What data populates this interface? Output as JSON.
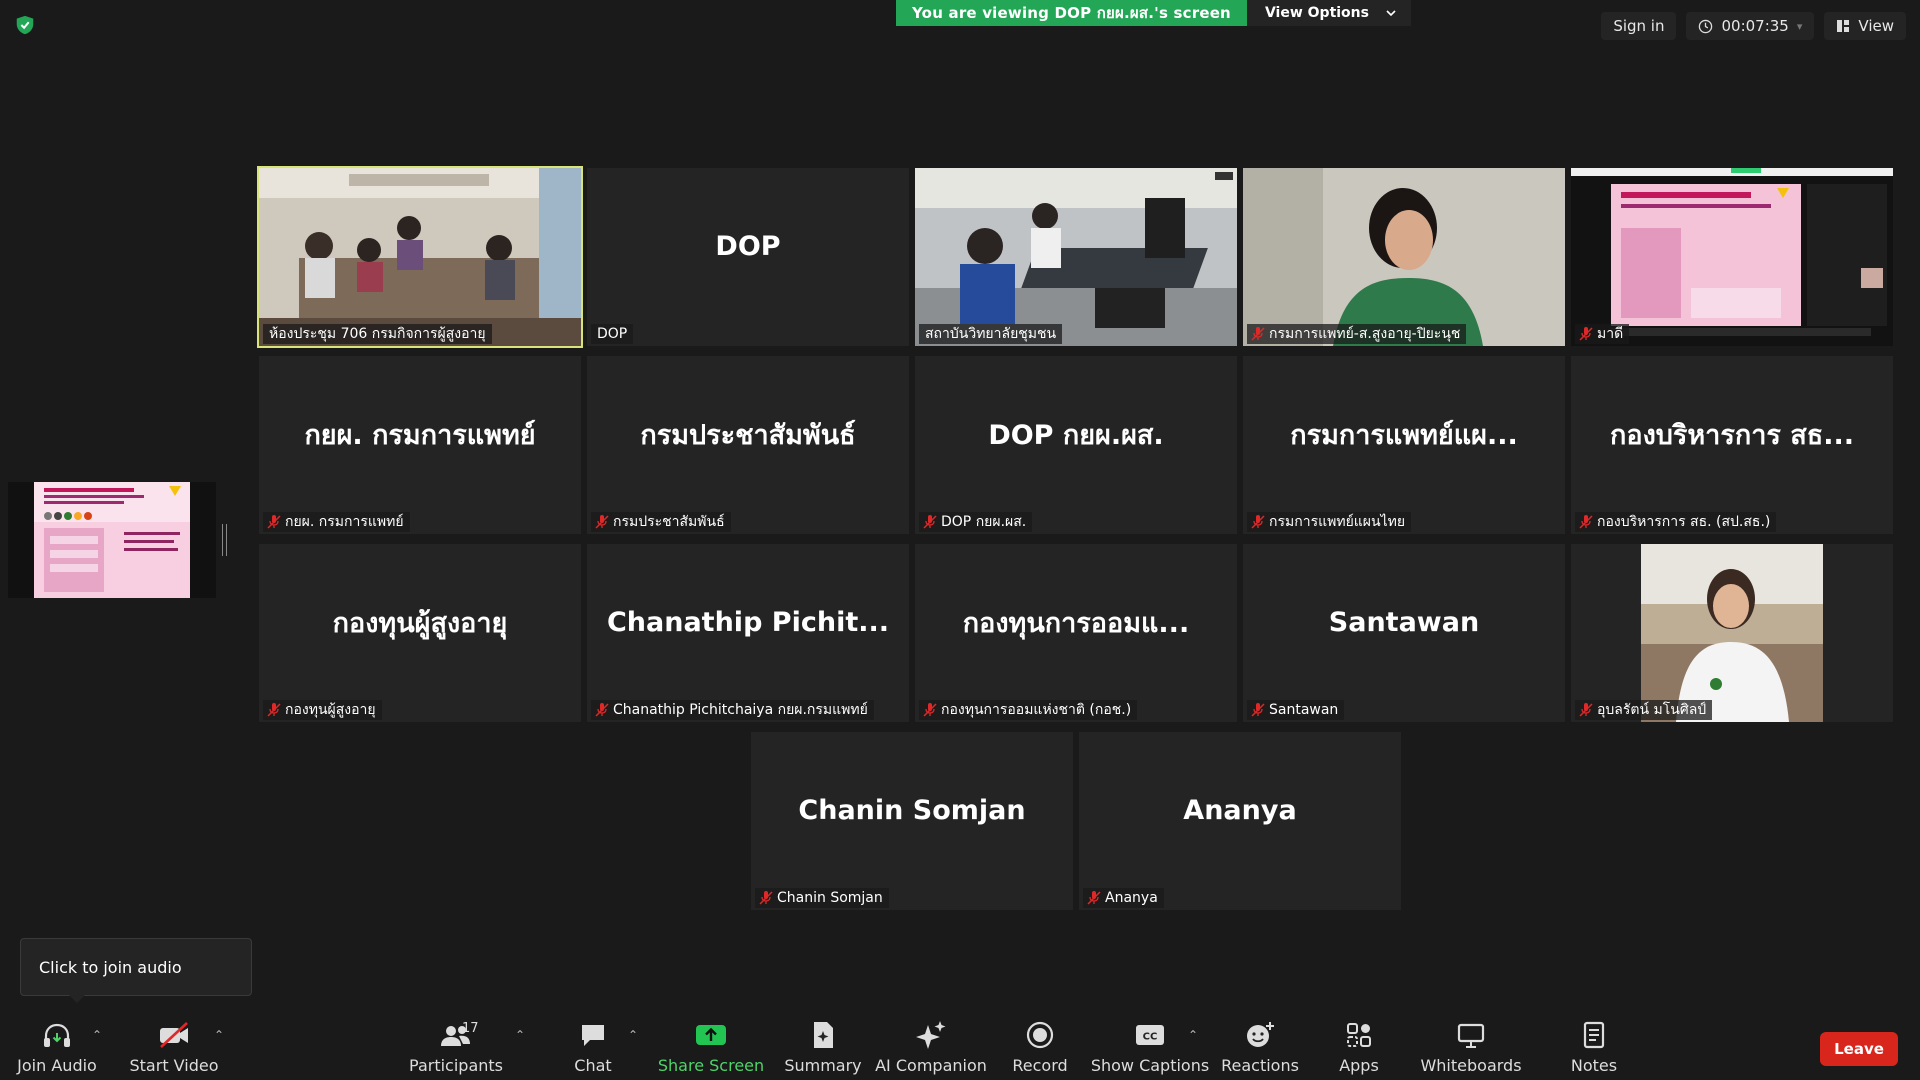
{
  "banner": {
    "message": "You are viewing DOP กยผ.ผส.'s screen",
    "view_options": "View Options"
  },
  "top_right": {
    "sign_in": "Sign in",
    "timer": "00:07:35",
    "view": "View"
  },
  "tiles": [
    {
      "label": "ห้องประชุม 706 กรมกิจการผู้สูงอายุ",
      "muted": false
    },
    {
      "big": "DOP",
      "label": "DOP",
      "muted": false
    },
    {
      "label": "สถาบันวิทยาลัยชุมชน",
      "muted": false
    },
    {
      "label": "กรมการแพทย์-ส.สูงอายุ-ปิยะนุช",
      "muted": true
    },
    {
      "label": "มาดี",
      "muted": true
    },
    {
      "big": "กยผ. กรมการแพทย์",
      "label": "กยผ. กรมการแพทย์",
      "muted": true
    },
    {
      "big": "กรมประชาสัมพันธ์",
      "label": "กรมประชาสัมพันธ์",
      "muted": true
    },
    {
      "big": "DOP กยผ.ผส.",
      "label": "DOP กยผ.ผส.",
      "muted": true
    },
    {
      "big": "กรมการแพทย์แผ...",
      "label": "กรมการแพทย์แผนไทย",
      "muted": true
    },
    {
      "big": "กองบริหารการ สธ...",
      "label": "กองบริหารการ สธ. (สป.สธ.)",
      "muted": true
    },
    {
      "big": "กองทุนผู้สูงอายุ",
      "label": "กองทุนผู้สูงอายุ",
      "muted": true
    },
    {
      "big": "Chanathip  Pichit...",
      "label": "Chanathip Pichitchaiya กยผ.กรมแพทย์",
      "muted": true
    },
    {
      "big": "กองทุนการออมแ...",
      "label": "กองทุนการออมแห่งชาติ (กอช.)",
      "muted": true
    },
    {
      "big": "Santawan",
      "label": "Santawan",
      "muted": true
    },
    {
      "label": "อุบลรัตน์ มโนศิลป์",
      "muted": true
    },
    {
      "big": "Chanin Somjan",
      "label": "Chanin Somjan",
      "muted": true
    },
    {
      "big": "Ananya",
      "label": "Ananya",
      "muted": true
    }
  ],
  "tooltip": "Click to join audio",
  "toolbar": {
    "join_audio": "Join Audio",
    "start_video": "Start Video",
    "participants": "Participants",
    "participants_count": "17",
    "chat": "Chat",
    "share_screen": "Share Screen",
    "summary": "Summary",
    "ai_companion": "AI Companion",
    "record": "Record",
    "show_captions": "Show Captions",
    "reactions": "Reactions",
    "apps": "Apps",
    "whiteboards": "Whiteboards",
    "notes": "Notes",
    "leave": "Leave"
  },
  "colors": {
    "banner_green": "#23a757",
    "active_outline": "#d8e47a",
    "leave_red": "#d9261c",
    "share_green": "#4fd36a"
  }
}
